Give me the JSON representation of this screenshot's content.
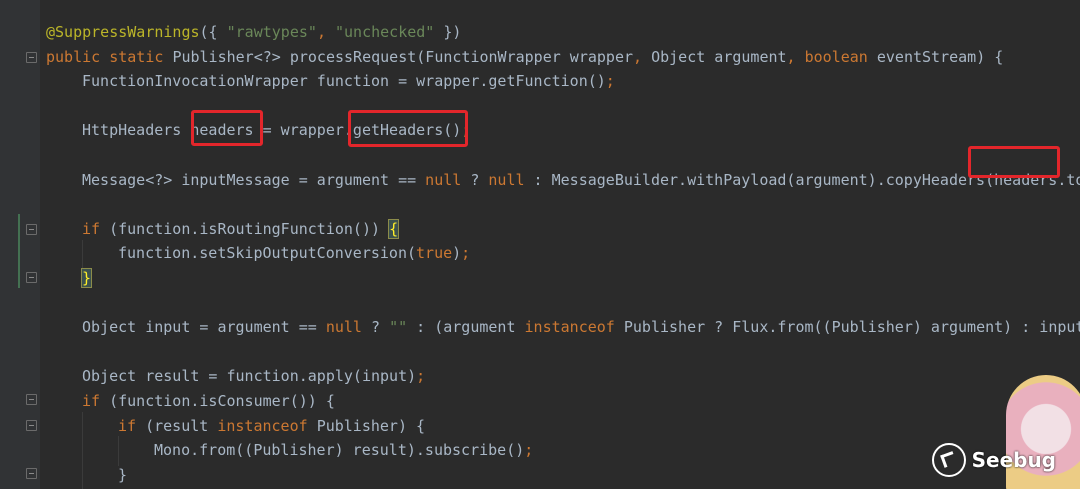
{
  "editor": {
    "lines": [
      {
        "indent": 0,
        "tokens": [
          {
            "t": "@SuppressWarnings",
            "c": "ann"
          },
          {
            "t": "({ ",
            "c": ""
          },
          {
            "t": "\"rawtypes\"",
            "c": "str"
          },
          {
            "t": ", ",
            "c": "punc"
          },
          {
            "t": "\"unchecked\"",
            "c": "str"
          },
          {
            "t": " })",
            "c": ""
          }
        ]
      },
      {
        "indent": 0,
        "tokens": [
          {
            "t": "public static ",
            "c": "kw"
          },
          {
            "t": "Publisher<?> processRequest(FunctionWrapper wrapper",
            "c": ""
          },
          {
            "t": ", ",
            "c": "punc"
          },
          {
            "t": "Object argument",
            "c": ""
          },
          {
            "t": ", ",
            "c": "punc"
          },
          {
            "t": "boolean ",
            "c": "kw"
          },
          {
            "t": "eventStream) {",
            "c": ""
          }
        ]
      },
      {
        "indent": 1,
        "tokens": [
          {
            "t": "FunctionInvocationWrapper function = wrapper.getFunction()",
            "c": ""
          },
          {
            "t": ";",
            "c": "punc"
          }
        ]
      },
      {
        "indent": 0,
        "tokens": []
      },
      {
        "indent": 1,
        "tokens": [
          {
            "t": "HttpHeaders headers = wrapper.getHeaders()",
            "c": ""
          },
          {
            "t": ";",
            "c": "punc"
          }
        ]
      },
      {
        "indent": 0,
        "tokens": []
      },
      {
        "indent": 1,
        "tokens": [
          {
            "t": "Message<?> inputMessage = argument == ",
            "c": ""
          },
          {
            "t": "null ",
            "c": "kw"
          },
          {
            "t": "? ",
            "c": ""
          },
          {
            "t": "null ",
            "c": "kw"
          },
          {
            "t": ": MessageBuilder.withPayload(argument).copyHeaders(headers.toS",
            "c": ""
          }
        ]
      },
      {
        "indent": 0,
        "tokens": []
      },
      {
        "indent": 1,
        "tokens": [
          {
            "t": "if ",
            "c": "kw"
          },
          {
            "t": "(function.isRoutingFunction()) ",
            "c": ""
          },
          {
            "t": "{",
            "c": "brace"
          },
          {
            "t": "",
            "c": "caret"
          }
        ]
      },
      {
        "indent": 2,
        "tokens": [
          {
            "t": "function.setSkipOutputConversion(",
            "c": ""
          },
          {
            "t": "true",
            "c": "kw"
          },
          {
            "t": ")",
            "c": ""
          },
          {
            "t": ";",
            "c": "punc"
          }
        ]
      },
      {
        "indent": 1,
        "tokens": [
          {
            "t": "}",
            "c": "brace"
          }
        ]
      },
      {
        "indent": 0,
        "tokens": []
      },
      {
        "indent": 1,
        "tokens": [
          {
            "t": "Object input = argument == ",
            "c": ""
          },
          {
            "t": "null ",
            "c": "kw"
          },
          {
            "t": "? ",
            "c": ""
          },
          {
            "t": "\"\" ",
            "c": "str"
          },
          {
            "t": ": (argument ",
            "c": ""
          },
          {
            "t": "instanceof ",
            "c": "kw"
          },
          {
            "t": "Publisher ? Flux.from((Publisher) argument) : inputM",
            "c": ""
          }
        ]
      },
      {
        "indent": 0,
        "tokens": []
      },
      {
        "indent": 1,
        "tokens": [
          {
            "t": "Object result = function.apply(input)",
            "c": ""
          },
          {
            "t": ";",
            "c": "punc"
          }
        ]
      },
      {
        "indent": 1,
        "tokens": [
          {
            "t": "if ",
            "c": "kw"
          },
          {
            "t": "(function.isConsumer()) {",
            "c": ""
          }
        ]
      },
      {
        "indent": 2,
        "tokens": [
          {
            "t": "if ",
            "c": "kw"
          },
          {
            "t": "(result ",
            "c": ""
          },
          {
            "t": "instanceof ",
            "c": "kw"
          },
          {
            "t": "Publisher) {",
            "c": ""
          }
        ]
      },
      {
        "indent": 3,
        "tokens": [
          {
            "t": "Mono.from((Publisher) result).subscribe()",
            "c": ""
          },
          {
            "t": ";",
            "c": "punc"
          }
        ]
      },
      {
        "indent": 2,
        "tokens": [
          {
            "t": "}",
            "c": ""
          }
        ]
      }
    ]
  },
  "watermark": {
    "text": "Seebug"
  }
}
